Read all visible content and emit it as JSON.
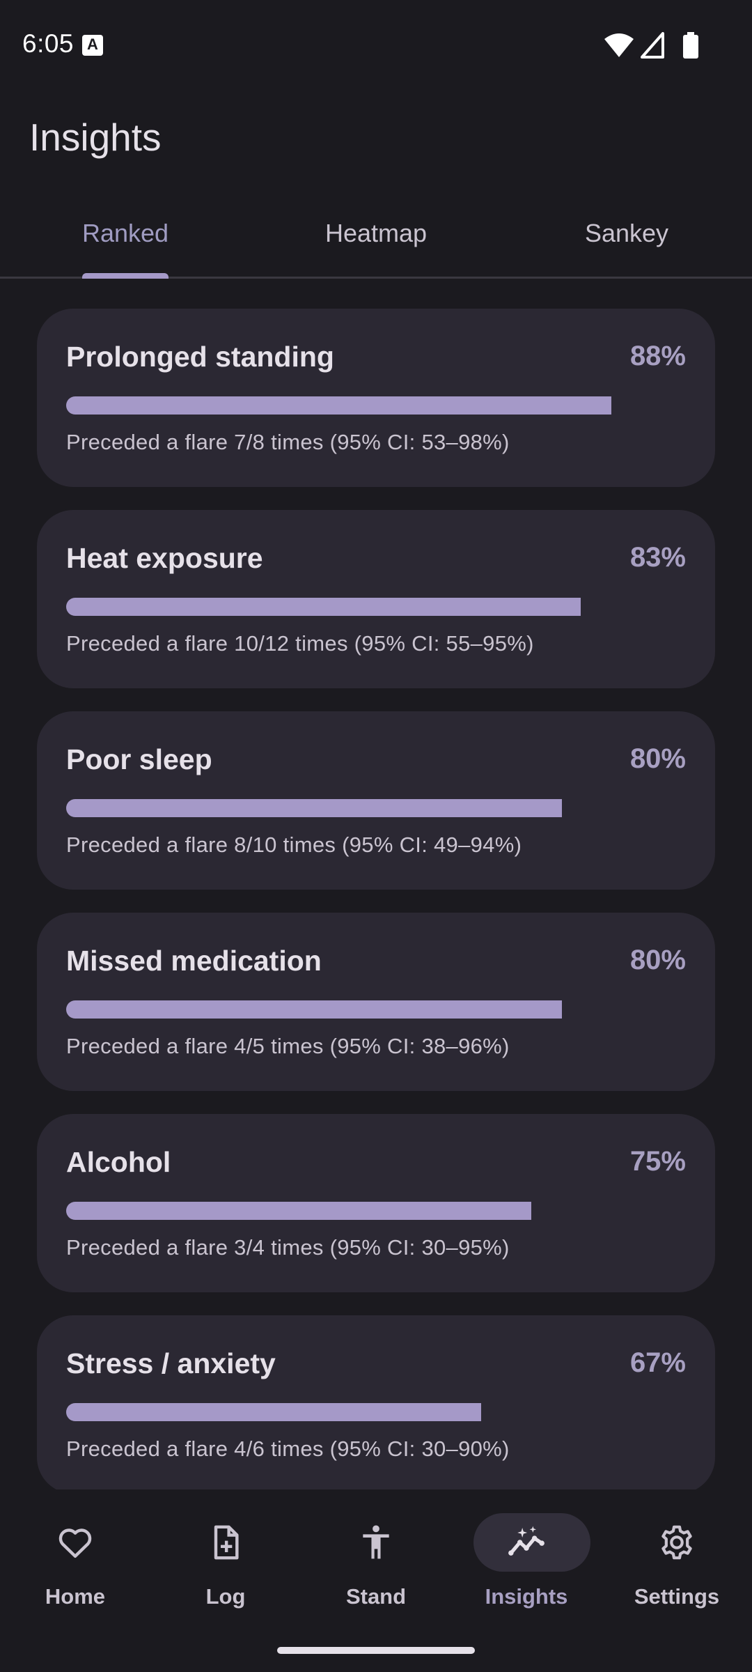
{
  "status_bar": {
    "time": "6:05",
    "notification_letter": "A"
  },
  "app_bar": {
    "title": "Insights"
  },
  "tabs": [
    {
      "label": "Ranked",
      "active": true
    },
    {
      "label": "Heatmap",
      "active": false
    },
    {
      "label": "Sankey",
      "active": false
    }
  ],
  "triggers": [
    {
      "name": "Prolonged standing",
      "percent": "88%",
      "fraction": 0.88,
      "desc": "Preceded a flare 7/8 times (95% CI: 53–98%)"
    },
    {
      "name": "Heat exposure",
      "percent": "83%",
      "fraction": 0.83,
      "desc": "Preceded a flare 10/12 times (95% CI: 55–95%)"
    },
    {
      "name": "Poor sleep",
      "percent": "80%",
      "fraction": 0.8,
      "desc": "Preceded a flare 8/10 times (95% CI: 49–94%)"
    },
    {
      "name": "Missed medication",
      "percent": "80%",
      "fraction": 0.8,
      "desc": "Preceded a flare 4/5 times (95% CI: 38–96%)"
    },
    {
      "name": "Alcohol",
      "percent": "75%",
      "fraction": 0.75,
      "desc": "Preceded a flare 3/4 times (95% CI: 30–95%)"
    },
    {
      "name": "Stress / anxiety",
      "percent": "67%",
      "fraction": 0.67,
      "desc": "Preceded a flare 4/6 times (95% CI: 30–90%)"
    }
  ],
  "bottom_nav": [
    {
      "label": "Home",
      "icon": "heart-icon",
      "active": false
    },
    {
      "label": "Log",
      "icon": "note-add-icon",
      "active": false
    },
    {
      "label": "Stand",
      "icon": "person-standing-icon",
      "active": false
    },
    {
      "label": "Insights",
      "icon": "insights-icon",
      "active": true
    },
    {
      "label": "Settings",
      "icon": "gear-icon",
      "active": false
    }
  ],
  "colors": {
    "accent": "#a599c8",
    "background": "#1b1a1f",
    "card": "#2b2833"
  }
}
